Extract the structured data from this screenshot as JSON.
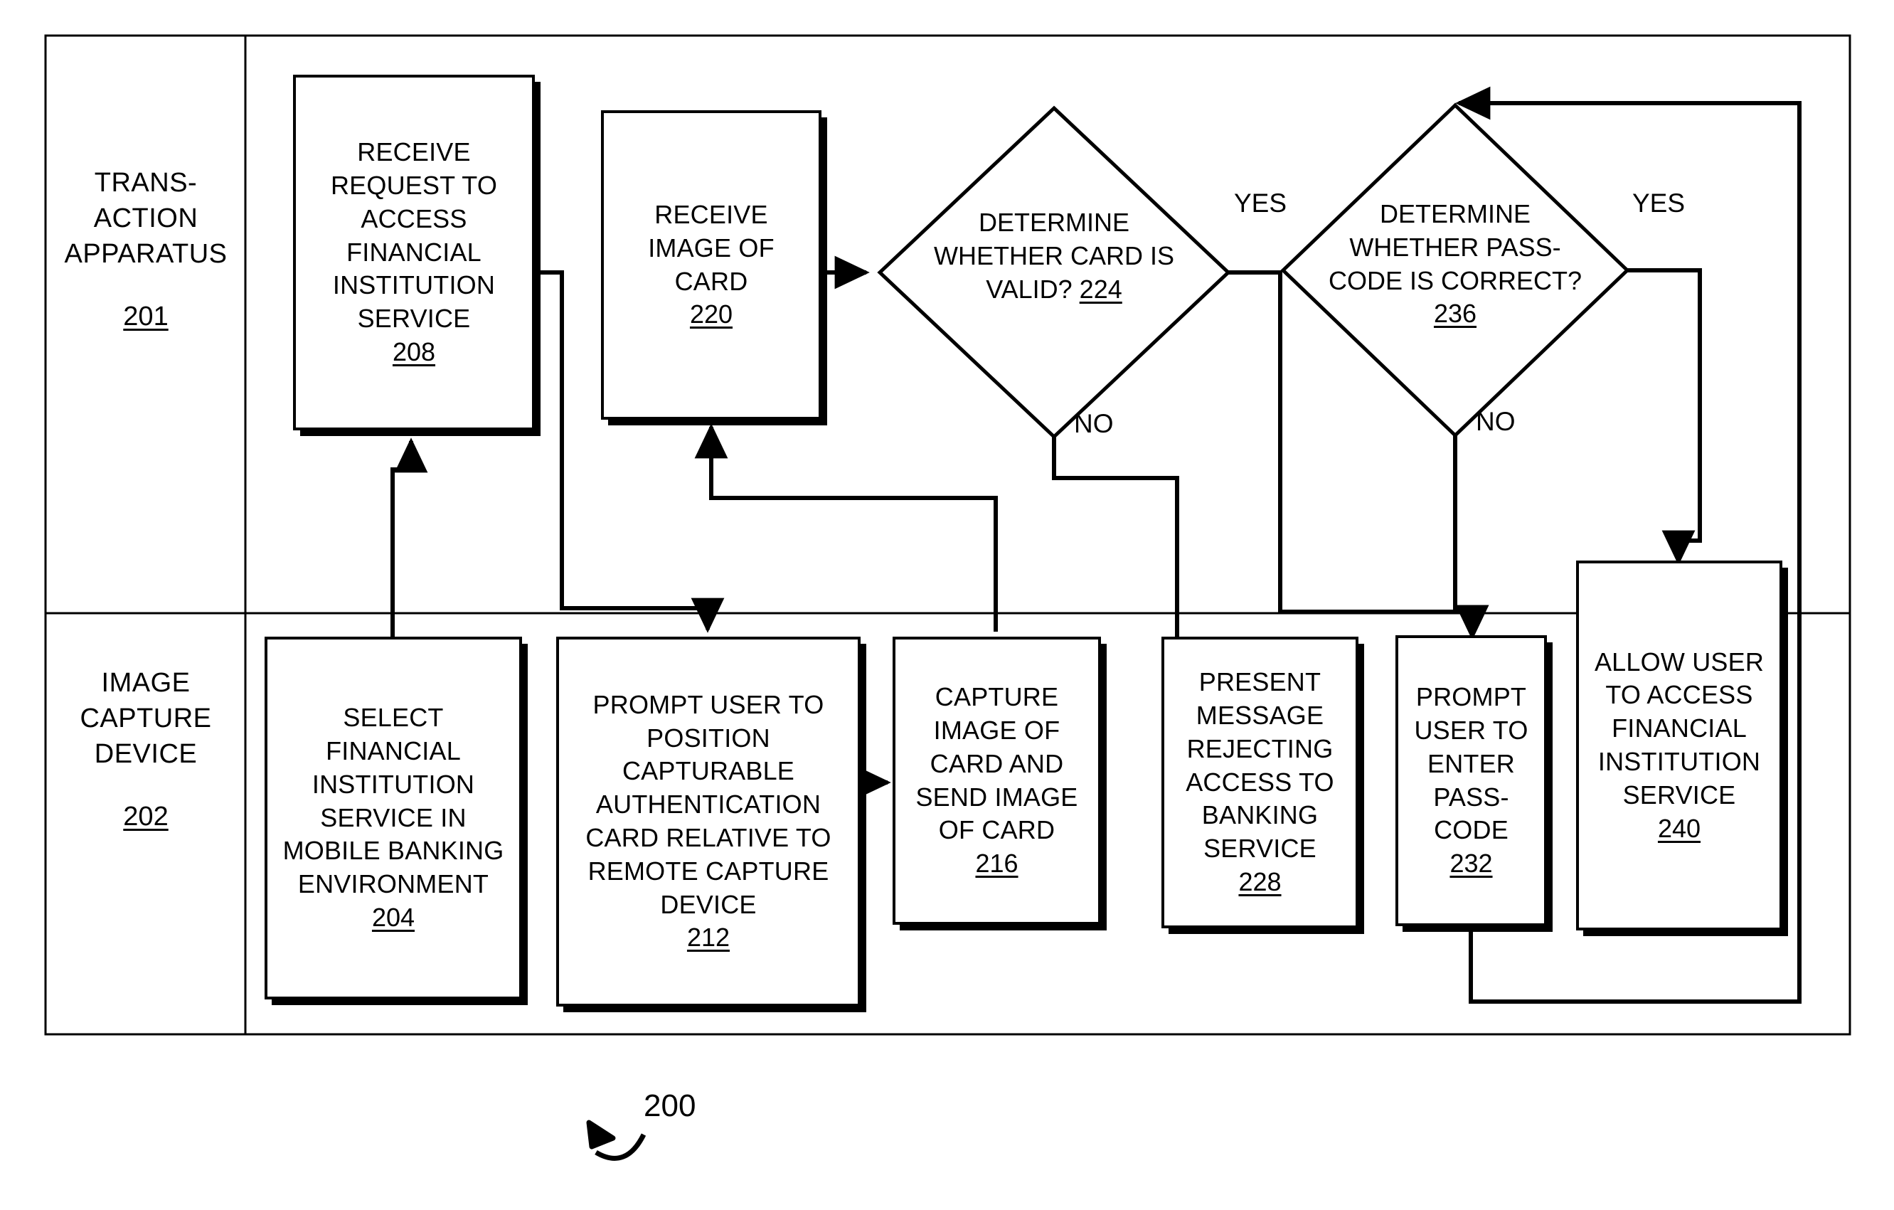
{
  "figure": {
    "number": "200",
    "title_ref": "200"
  },
  "lanes": [
    {
      "id": "transaction-apparatus",
      "lines": [
        "TRANS-",
        "ACTION",
        "APPARATUS"
      ],
      "number": "201"
    },
    {
      "id": "image-capture-device",
      "lines": [
        "IMAGE",
        "CAPTURE",
        "DEVICE"
      ],
      "number": "202"
    }
  ],
  "nodes": [
    {
      "id": "receive-request",
      "shape": "process",
      "lines": [
        "RECEIVE",
        "REQUEST TO",
        "ACCESS",
        "FINANCIAL",
        "INSTITUTION",
        "SERVICE"
      ],
      "number": "208"
    },
    {
      "id": "receive-image-of-card",
      "shape": "process",
      "lines": [
        "RECEIVE",
        "IMAGE OF",
        "CARD"
      ],
      "number": "220"
    },
    {
      "id": "determine-card-valid",
      "shape": "decision",
      "lines": [
        "DETERMINE",
        "WHETHER CARD IS",
        "VALID?"
      ],
      "number": "224",
      "inline_number": true
    },
    {
      "id": "determine-passcode-correct",
      "shape": "decision",
      "lines": [
        "DETERMINE",
        "WHETHER PASS-",
        "CODE IS CORRECT?"
      ],
      "number": "236"
    },
    {
      "id": "select-financial-institution-service",
      "shape": "process",
      "lines": [
        "SELECT",
        "FINANCIAL",
        "INSTITUTION",
        "SERVICE IN",
        "MOBILE BANKING",
        "ENVIRONMENT"
      ],
      "number": "204"
    },
    {
      "id": "prompt-user-position-card",
      "shape": "process",
      "lines": [
        "PROMPT USER TO",
        "POSITION",
        "CAPTURABLE",
        "AUTHENTICATION",
        "CARD RELATIVE TO",
        "REMOTE CAPTURE",
        "DEVICE"
      ],
      "number": "212"
    },
    {
      "id": "capture-and-send-image",
      "shape": "process",
      "lines": [
        "CAPTURE",
        "IMAGE OF",
        "CARD AND",
        "SEND IMAGE",
        "OF CARD"
      ],
      "number": "216"
    },
    {
      "id": "present-reject-message",
      "shape": "process",
      "lines": [
        "PRESENT",
        "MESSAGE",
        "REJECTING",
        "ACCESS TO",
        "BANKING",
        "SERVICE"
      ],
      "number": "228"
    },
    {
      "id": "prompt-user-enter-passcode",
      "shape": "process",
      "lines": [
        "PROMPT",
        "USER TO",
        "ENTER",
        "PASS-",
        "CODE"
      ],
      "number": "232"
    },
    {
      "id": "allow-user-access",
      "shape": "process",
      "lines": [
        "ALLOW USER",
        "TO ACCESS",
        "FINANCIAL",
        "INSTITUTION",
        "SERVICE"
      ],
      "number": "240"
    }
  ],
  "edge_labels": {
    "card_valid_yes": "YES",
    "card_valid_no": "NO",
    "passcode_yes": "YES",
    "passcode_no": "NO"
  },
  "colors": {
    "ink": "#000000",
    "paper": "#ffffff"
  }
}
